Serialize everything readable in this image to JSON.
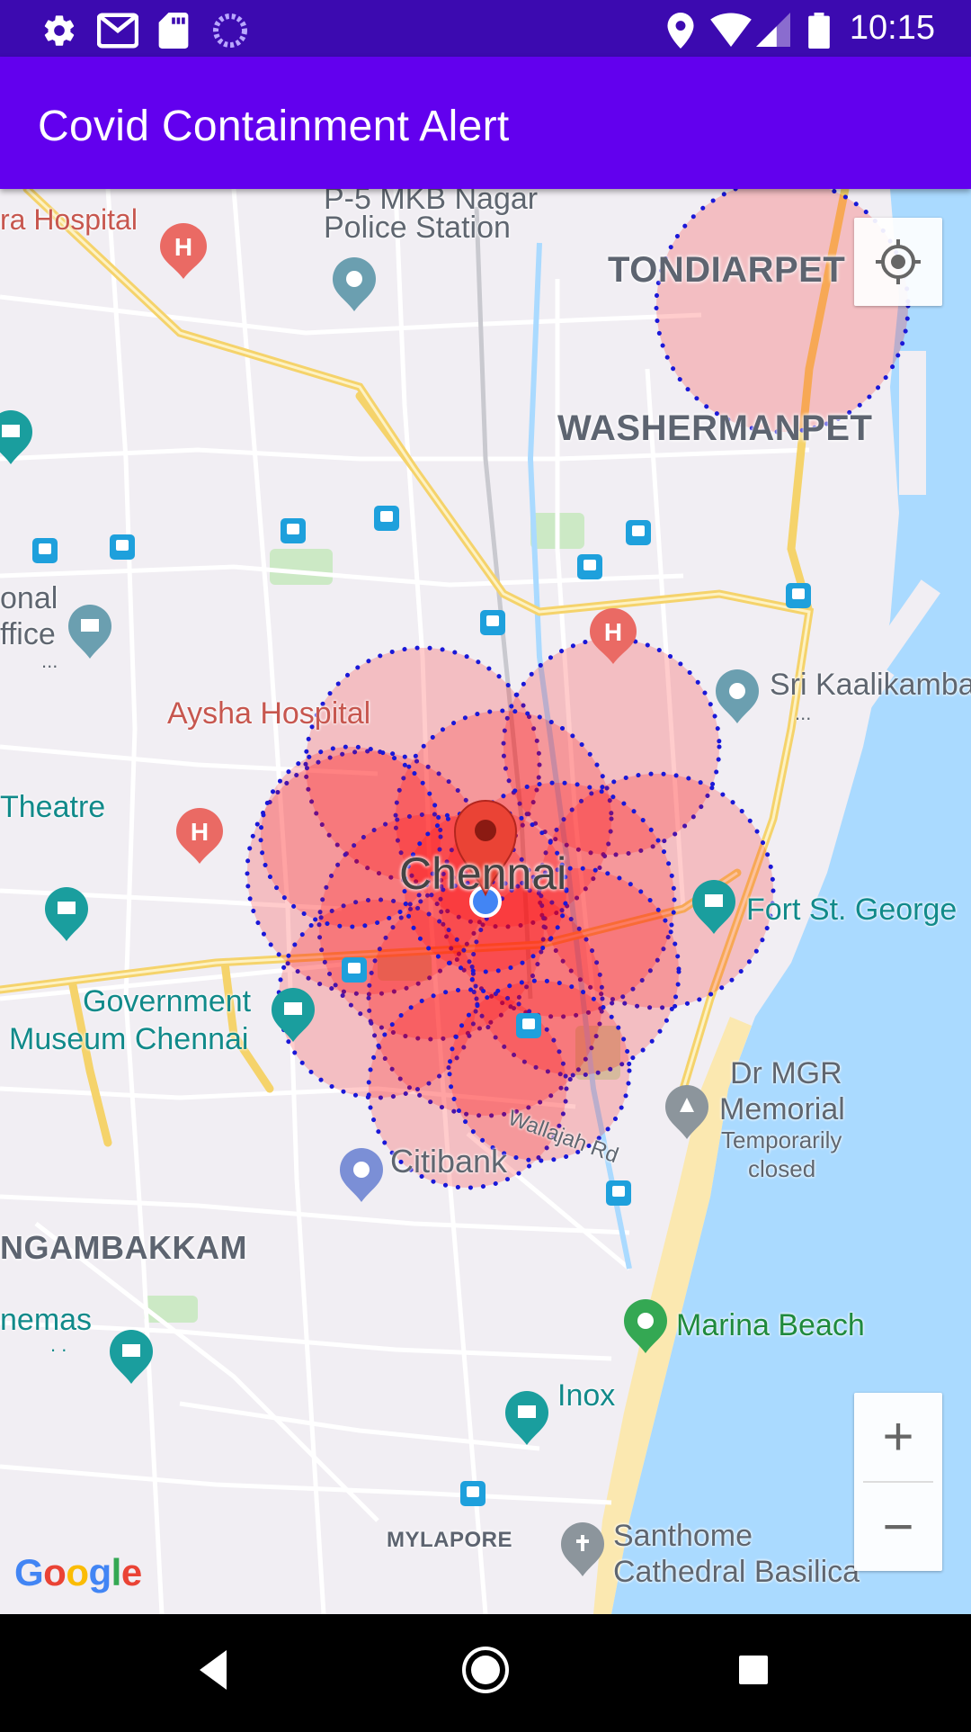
{
  "status_bar": {
    "time": "10:15",
    "left_icons": [
      "settings-icon",
      "gmail-icon",
      "sd-card-icon",
      "sync-icon"
    ],
    "right_icons": [
      "location-icon",
      "wifi-icon",
      "signal-icon",
      "battery-icon"
    ]
  },
  "app_bar": {
    "title": "Covid Containment Alert",
    "color": "#6200ee"
  },
  "map": {
    "city_label": "Chennai",
    "areas": [
      "TONDIARPET",
      "WASHERMANPET",
      "NGAMBAKKAM",
      "MYLAPORE"
    ],
    "pois": {
      "hospital_top": "ra Hospital",
      "police_station_1": "P-5 MKB Nagar",
      "police_station_2": "Police Station",
      "office_1": "onal",
      "office_2": "ffice",
      "office_3": "...",
      "aysha": "Aysha Hospital",
      "theatre": "Theatre",
      "sri_kaali": "Sri Kaalikamba",
      "sri_kaali_more": "...",
      "fort": "Fort St. George",
      "museum_1": "Government",
      "museum_2": "Museum Chennai",
      "dr_mgr_1": "Dr MGR",
      "dr_mgr_2": "Memorial",
      "dr_mgr_3": "Temporarily",
      "dr_mgr_4": "closed",
      "citibank": "Citibank",
      "wallajah": "Wallajah Rd",
      "cinemas": "nemas",
      "cinemas_more": ". .",
      "marina": "Marina Beach",
      "inox": "Inox",
      "santhome_1": "Santhome",
      "santhome_2": "Cathedral Basilica"
    },
    "zoom_in": "+",
    "zoom_out": "−",
    "google": {
      "G": "G",
      "o1": "o",
      "o2": "o",
      "g": "g",
      "l": "l",
      "e": "e"
    },
    "containment_fill": "#ff0000",
    "containment_border": "#1a18d8"
  }
}
